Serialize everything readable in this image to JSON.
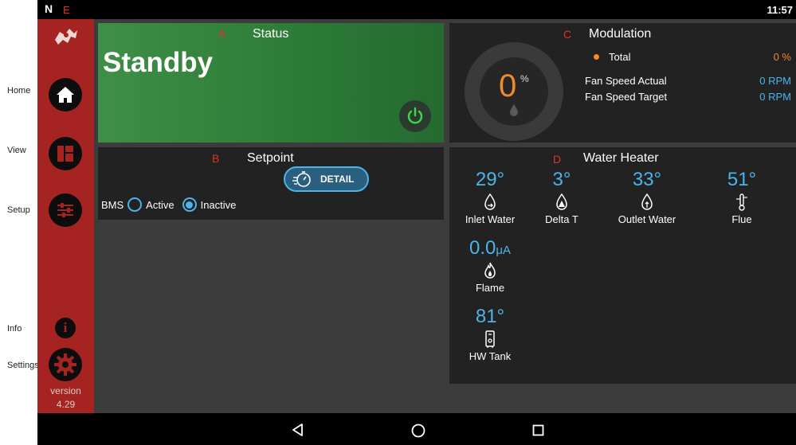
{
  "outer_labels": {
    "home": "Home",
    "view": "View",
    "setup": "Setup",
    "info": "Info",
    "settings": "Settings"
  },
  "statusbar": {
    "logo": "N",
    "time": "11:57"
  },
  "markers": {
    "a": "A",
    "b": "B",
    "c": "C",
    "d": "D",
    "e": "E"
  },
  "sidebar": {
    "version_label": "version",
    "version_number": "4.29"
  },
  "status": {
    "title": "Status",
    "state": "Standby"
  },
  "setpoint": {
    "title": "Setpoint",
    "detail_label": "DETAIL",
    "bms_label": "BMS",
    "active_label": "Active",
    "inactive_label": "Inactive",
    "selected": "Inactive"
  },
  "modulation": {
    "title": "Modulation",
    "gauge_value": "0",
    "gauge_unit": "%",
    "total_label": "Total",
    "total_value": "0 %",
    "fan_actual_label": "Fan Speed Actual",
    "fan_actual_value": "0 RPM",
    "fan_target_label": "Fan Speed Target",
    "fan_target_value": "0 RPM"
  },
  "water_heater": {
    "title": "Water Heater",
    "inlet": {
      "value": "29°",
      "label": "Inlet Water"
    },
    "delta": {
      "value": "3°",
      "label": "Delta T"
    },
    "outlet": {
      "value": "33°",
      "label": "Outlet Water"
    },
    "flue": {
      "value": "51°",
      "label": "Flue"
    },
    "flame": {
      "value": "0.0",
      "unit": "μA",
      "label": "Flame"
    },
    "tank": {
      "value": "81°",
      "label": "HW Tank"
    }
  },
  "colors": {
    "accent": "#4bb5ea",
    "sidebar": "#a52422",
    "status_green": "#3f8f46",
    "modulation_orange": "#f28a2c",
    "power_green": "#43d04a"
  }
}
